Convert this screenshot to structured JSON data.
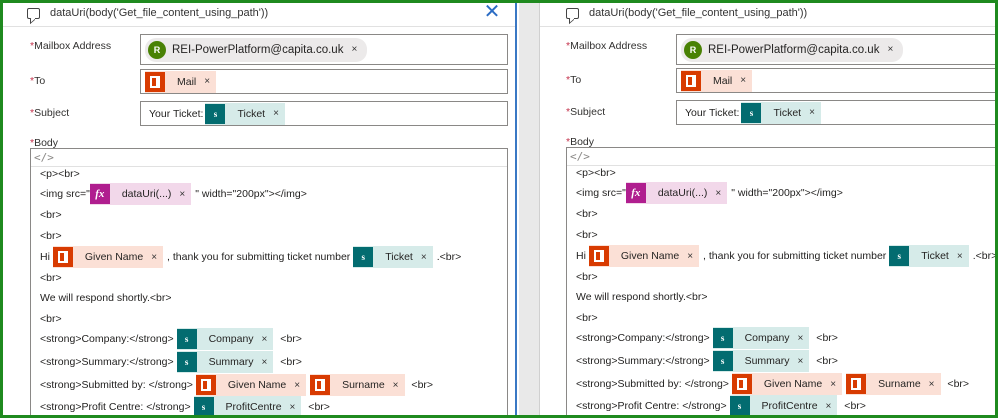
{
  "panel": {
    "title": "dataUri(body('Get_file_content_using_path'))",
    "close_label": "✕"
  },
  "fields": {
    "mailbox": {
      "label": "Mailbox Address",
      "avatar_initial": "R",
      "value": "REI-PowerPlatform@capita.co.uk"
    },
    "to": {
      "label": "To",
      "token": "Mail"
    },
    "subject": {
      "label": "Subject",
      "prefix": "Your Ticket:",
      "token": "Ticket"
    },
    "body": {
      "label": "Body",
      "code_toggle": "</>"
    }
  },
  "required_marker": "*",
  "token_remove": "×",
  "icons": {
    "sharepoint_glyph": "s",
    "fx_glyph": "fx",
    "comment": "comment-icon"
  },
  "body_lines": [
    {
      "text": "<p><br>"
    },
    {
      "pre": "<img src=\"",
      "token": "dataUri(...)",
      "kind": "fx",
      "post": "\" width=\"200px\"></img>"
    },
    {
      "text": "<br>"
    },
    {
      "text": "<br>"
    },
    {
      "pre": "Hi ",
      "token": "Given Name",
      "kind": "office",
      "mid": ", thank you for submitting ticket number ",
      "token2": "Ticket",
      "kind2": "sp",
      "post": ".<br>"
    },
    {
      "text": "<br>"
    },
    {
      "text": "We will respond shortly.<br>"
    },
    {
      "text": "<br>"
    },
    {
      "pre": "<strong>Company:</strong> ",
      "token": "Company",
      "kind": "sp",
      "post": " <br>"
    },
    {
      "pre": "<strong>Summary:</strong> ",
      "token": "Summary",
      "kind": "sp",
      "post": " <br>"
    },
    {
      "pre": "<strong>Submitted by: </strong> ",
      "token": "Given Name",
      "kind": "office",
      "token2": "Surname",
      "kind2": "office",
      "post": " <br>"
    },
    {
      "pre": "<strong>Profit Centre: </strong> ",
      "token": "ProfitCentre",
      "kind": "sp",
      "post": " <br>"
    }
  ],
  "colors": {
    "frame": "#1f8a1f",
    "active_border": "#3a78c4",
    "office_icon": "#d83b01",
    "sharepoint_icon": "#036c70",
    "fx_icon": "#b01e8f",
    "required": "#c4314b"
  }
}
